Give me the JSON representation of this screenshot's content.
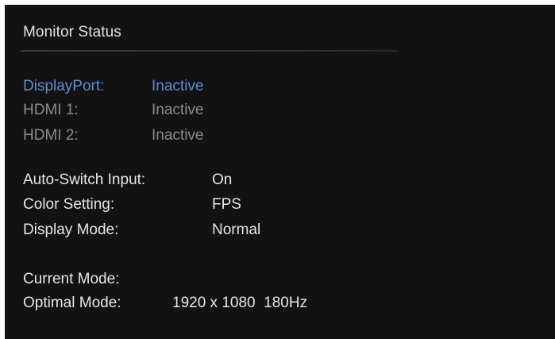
{
  "title": "Monitor Status",
  "inputs": [
    {
      "label": "DisplayPort:",
      "status": "Inactive",
      "state": "selected"
    },
    {
      "label": "HDMI 1:",
      "status": "Inactive",
      "state": "normal"
    },
    {
      "label": "HDMI 2:",
      "status": "Inactive",
      "state": "normal"
    }
  ],
  "settings": [
    {
      "label": "Auto-Switch Input:",
      "value": "On"
    },
    {
      "label": "Color Setting:",
      "value": "FPS"
    },
    {
      "label": "Display Mode:",
      "value": "Normal"
    }
  ],
  "modes": {
    "current_label": "Current Mode:",
    "current_value": "",
    "optimal_label": "Optimal Mode:",
    "optimal_value": "1920 x 1080  180Hz"
  },
  "colors": {
    "background": "#121212",
    "selected_text": "#5f8bd1",
    "inactive_text": "#8a8a8a",
    "primary_text": "#e6e6e6"
  }
}
